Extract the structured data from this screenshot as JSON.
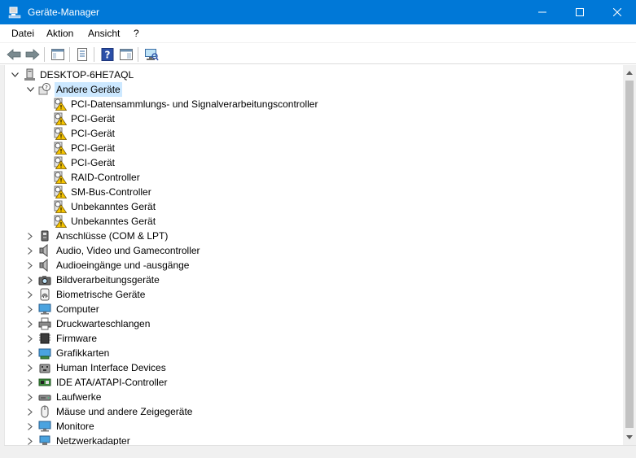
{
  "window": {
    "title": "Geräte-Manager",
    "accent": "#0078d7"
  },
  "menu": [
    "Datei",
    "Aktion",
    "Ansicht",
    "?"
  ],
  "toolbar": {
    "buttons": [
      "back-icon",
      "forward-icon",
      "show-hide-console-tree-icon",
      "properties-icon",
      "help-icon",
      "action-pane-icon",
      "scan-hardware-icon"
    ]
  },
  "tree": {
    "root": "DESKTOP-6HE7AQL",
    "expanded_category": "Andere Geräte",
    "other_devices": [
      "PCI-Datensammlungs- und Signalverarbeitungscontroller",
      "PCI-Gerät",
      "PCI-Gerät",
      "PCI-Gerät",
      "PCI-Gerät",
      "RAID-Controller",
      "SM-Bus-Controller",
      "Unbekanntes Gerät",
      "Unbekanntes Gerät"
    ],
    "categories": [
      {
        "label": "Anschlüsse (COM & LPT)",
        "icon": "port-icon"
      },
      {
        "label": "Audio, Video und Gamecontroller",
        "icon": "speaker-icon"
      },
      {
        "label": "Audioeingänge und -ausgänge",
        "icon": "speaker-icon"
      },
      {
        "label": "Bildverarbeitungsgeräte",
        "icon": "camera-icon"
      },
      {
        "label": "Biometrische Geräte",
        "icon": "fingerprint-icon"
      },
      {
        "label": "Computer",
        "icon": "monitor-icon"
      },
      {
        "label": "Druckwarteschlangen",
        "icon": "printer-icon"
      },
      {
        "label": "Firmware",
        "icon": "firmware-icon"
      },
      {
        "label": "Grafikkarten",
        "icon": "display-adapter-icon"
      },
      {
        "label": "Human Interface Devices",
        "icon": "hid-icon"
      },
      {
        "label": "IDE ATA/ATAPI-Controller",
        "icon": "ide-controller-icon"
      },
      {
        "label": "Laufwerke",
        "icon": "disk-drive-icon"
      },
      {
        "label": "Mäuse und andere Zeigegeräte",
        "icon": "mouse-icon"
      },
      {
        "label": "Monitore",
        "icon": "monitor-icon"
      },
      {
        "label": "Netzwerkadapter",
        "icon": "network-adapter-icon"
      }
    ]
  }
}
